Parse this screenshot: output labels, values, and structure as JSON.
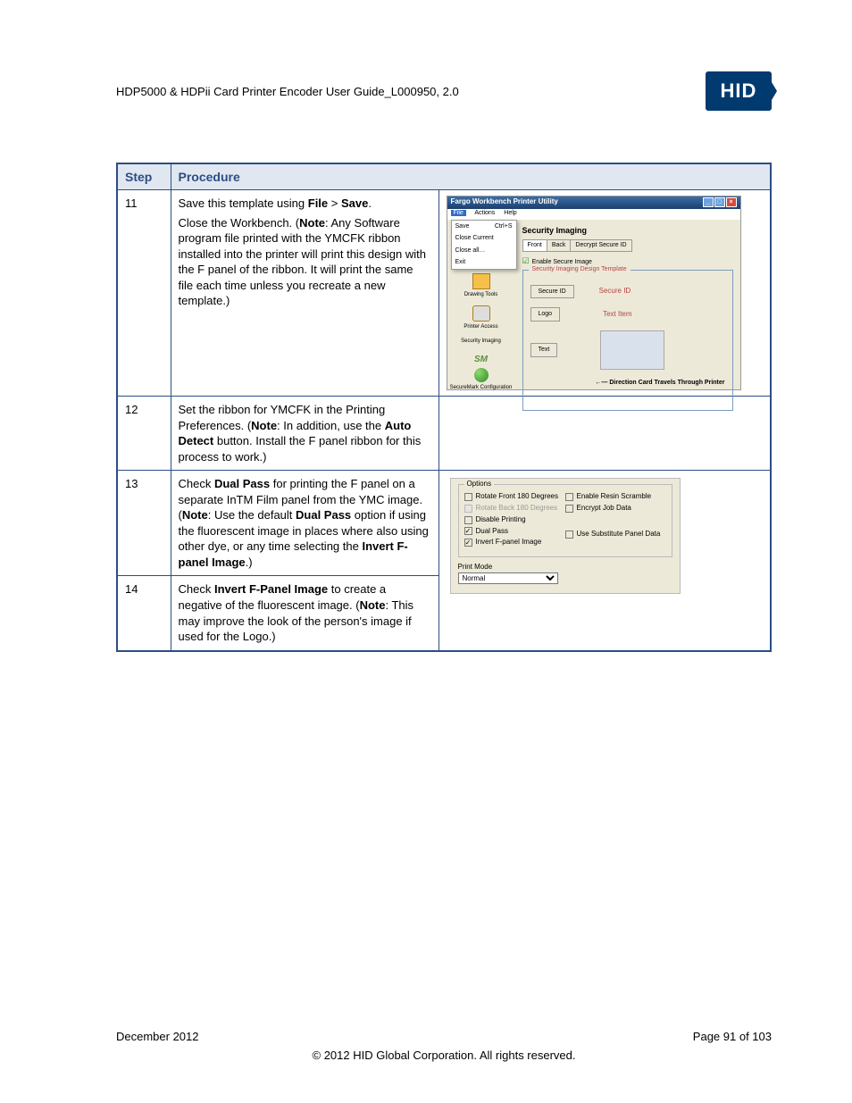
{
  "header": {
    "doc_title": "HDP5000 & HDPii Card Printer Encoder User Guide_L000950, 2.0",
    "logo_text": "HID"
  },
  "table": {
    "head_step": "Step",
    "head_proc": "Procedure",
    "rows": {
      "r11": {
        "step": "11",
        "p1a": "Save this template using ",
        "p1b": "File",
        "p1c": " > ",
        "p1d": "Save",
        "p1e": ".",
        "p2a": "Close the Workbench. (",
        "p2b": "Note",
        "p2c": ": Any Software program file printed with the YMCFK ribbon installed into the printer will print this design with the F panel of the ribbon. It will print the same file each time unless you recreate a new template.)"
      },
      "r12": {
        "step": "12",
        "a": "Set the ribbon for YMCFK in the Printing Preferences. (",
        "b": "Note",
        "c": ": In addition, use the ",
        "d": "Auto Detect",
        "e": " button. Install the F panel ribbon for this process to work.)"
      },
      "r13": {
        "step": "13",
        "a": "Check ",
        "b": "Dual Pass",
        "c": " for printing the F panel on a separate InTM Film panel from the YMC image. (",
        "d": "Note",
        "e": ": Use the default ",
        "f": "Dual Pass",
        "g": " option if using the fluorescent image in places where also using other dye, or any time selecting the ",
        "h": "Invert F-panel Image",
        "i": ".)"
      },
      "r14": {
        "step": "14",
        "a": "Check ",
        "b": "Invert F-Panel Image",
        "c": " to create a negative of the fluorescent image. (",
        "d": "Note",
        "e": ": This may improve the look of the person's image if used for the Logo.)"
      }
    }
  },
  "shot1": {
    "title": "Fargo Workbench Printer Utility",
    "menu_file": "File",
    "menu_actions": "Actions",
    "menu_help": "Help",
    "fm_save": "Save",
    "fm_save_sc": "Ctrl+S",
    "fm_close_current": "Close Current",
    "fm_close_all": "Close all…",
    "fm_exit": "Exit",
    "side_drawing": "Drawing Tools",
    "side_printer": "Printer Access",
    "side_security": "Security Imaging",
    "side_sm": "SM",
    "side_config": "SecureMark Configuration",
    "mp_title": "Security Imaging",
    "tab_front": "Front",
    "tab_back": "Back",
    "tab_decrypt": "Decrypt Secure ID",
    "chk_enable": "Enable Secure Image",
    "fs_legend": "Security Imaging Design Template",
    "btn_secureid": "Secure ID",
    "lbl_secureid": "Secure ID",
    "btn_logo": "Logo",
    "lbl_textitem": "Text Item",
    "btn_text": "Text",
    "arrow": "←— Direction Card Travels Through Printer"
  },
  "shot2": {
    "fs_label": "Options",
    "o_rotate_front": "Rotate Front 180 Degrees",
    "o_rotate_back": "Rotate Back 180 Degrees",
    "o_disable_print": "Disable Printing",
    "o_dual_pass": "Dual Pass",
    "o_invert": "Invert F-panel Image",
    "o_resin": "Enable Resin Scramble",
    "o_encrypt": "Encrypt Job Data",
    "o_subst": "Use Substitute Panel Data",
    "pm_label": "Print Mode",
    "pm_value": "Normal"
  },
  "footer": {
    "date": "December 2012",
    "page": "Page 91 of 103",
    "copyright": "© 2012 HID Global Corporation. All rights reserved."
  }
}
